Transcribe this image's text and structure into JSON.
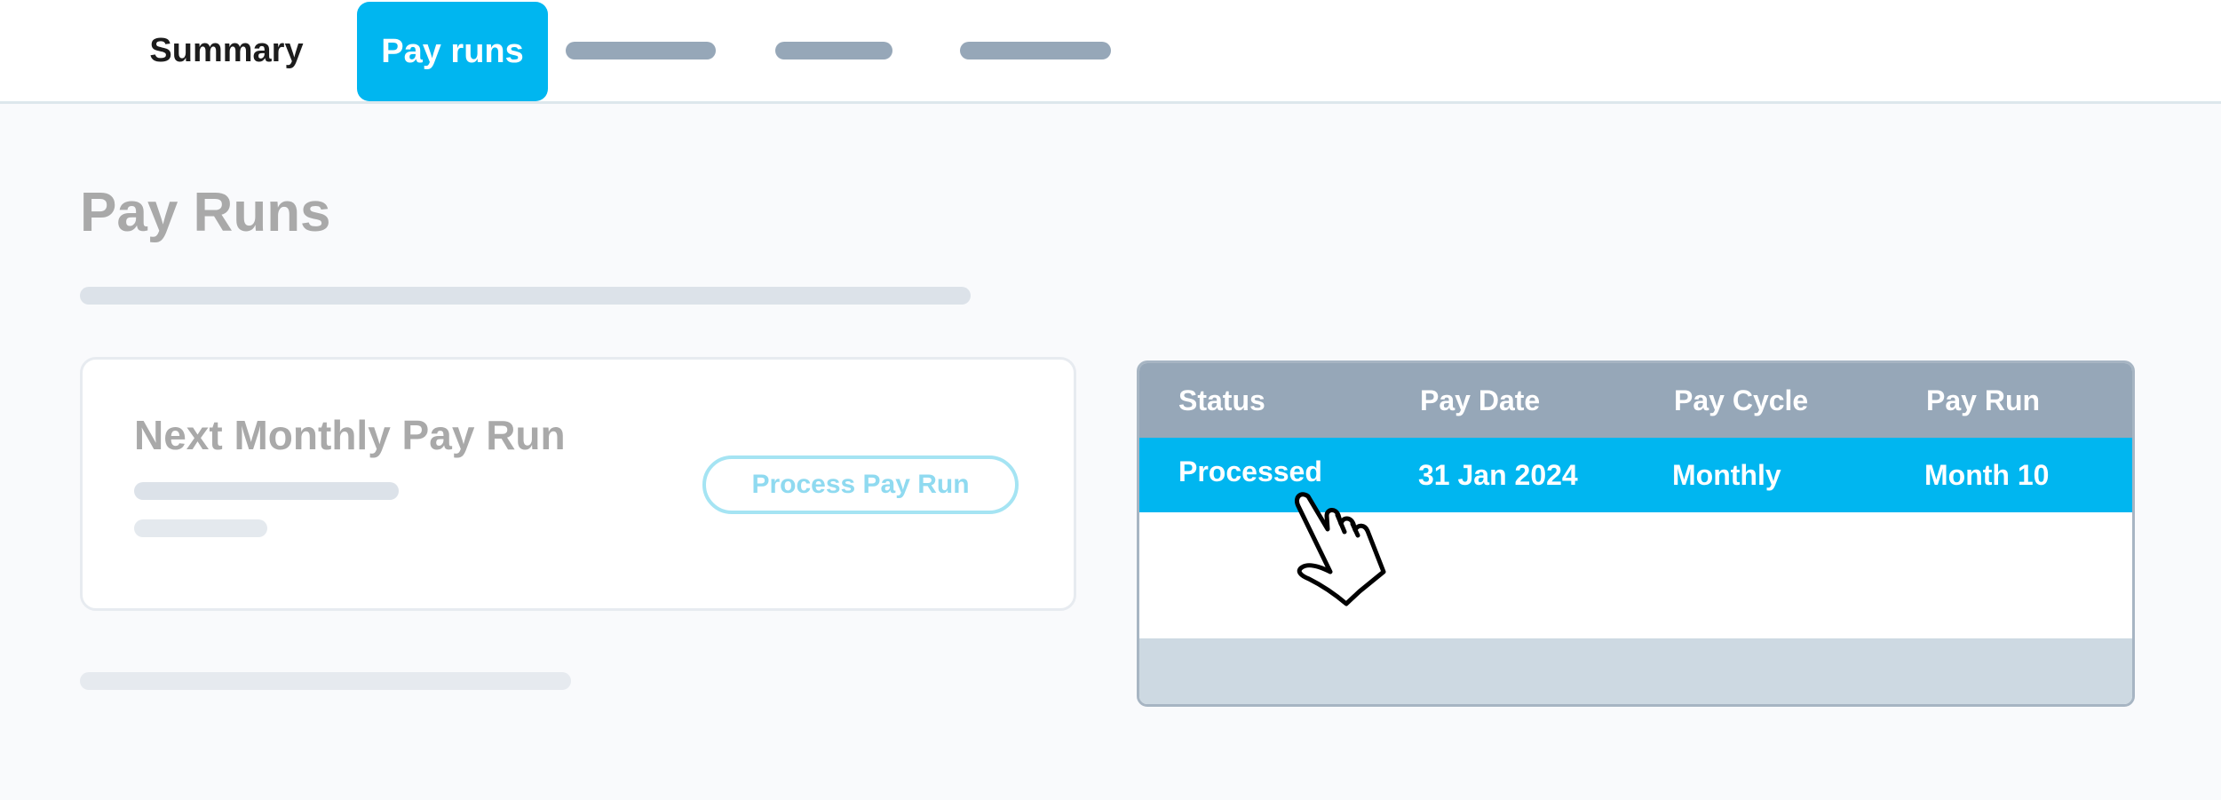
{
  "nav": {
    "tabs": [
      {
        "label": "Summary",
        "active": false
      },
      {
        "label": "Pay runs",
        "active": true
      }
    ],
    "active_color": "#00b6f0"
  },
  "page": {
    "title": "Pay Runs"
  },
  "next_run_card": {
    "title": "Next Monthly Pay Run",
    "button_label": "Process Pay Run"
  },
  "pay_runs_table": {
    "columns": [
      "Status",
      "Pay Date",
      "Pay Cycle",
      "Pay Run"
    ],
    "rows": [
      [
        "Processed",
        "31 Jan 2024",
        "Monthly",
        "Month 10"
      ]
    ],
    "highlight_color": "#00b6f0"
  },
  "icons": {
    "pointer": "hand-pointer-icon"
  }
}
